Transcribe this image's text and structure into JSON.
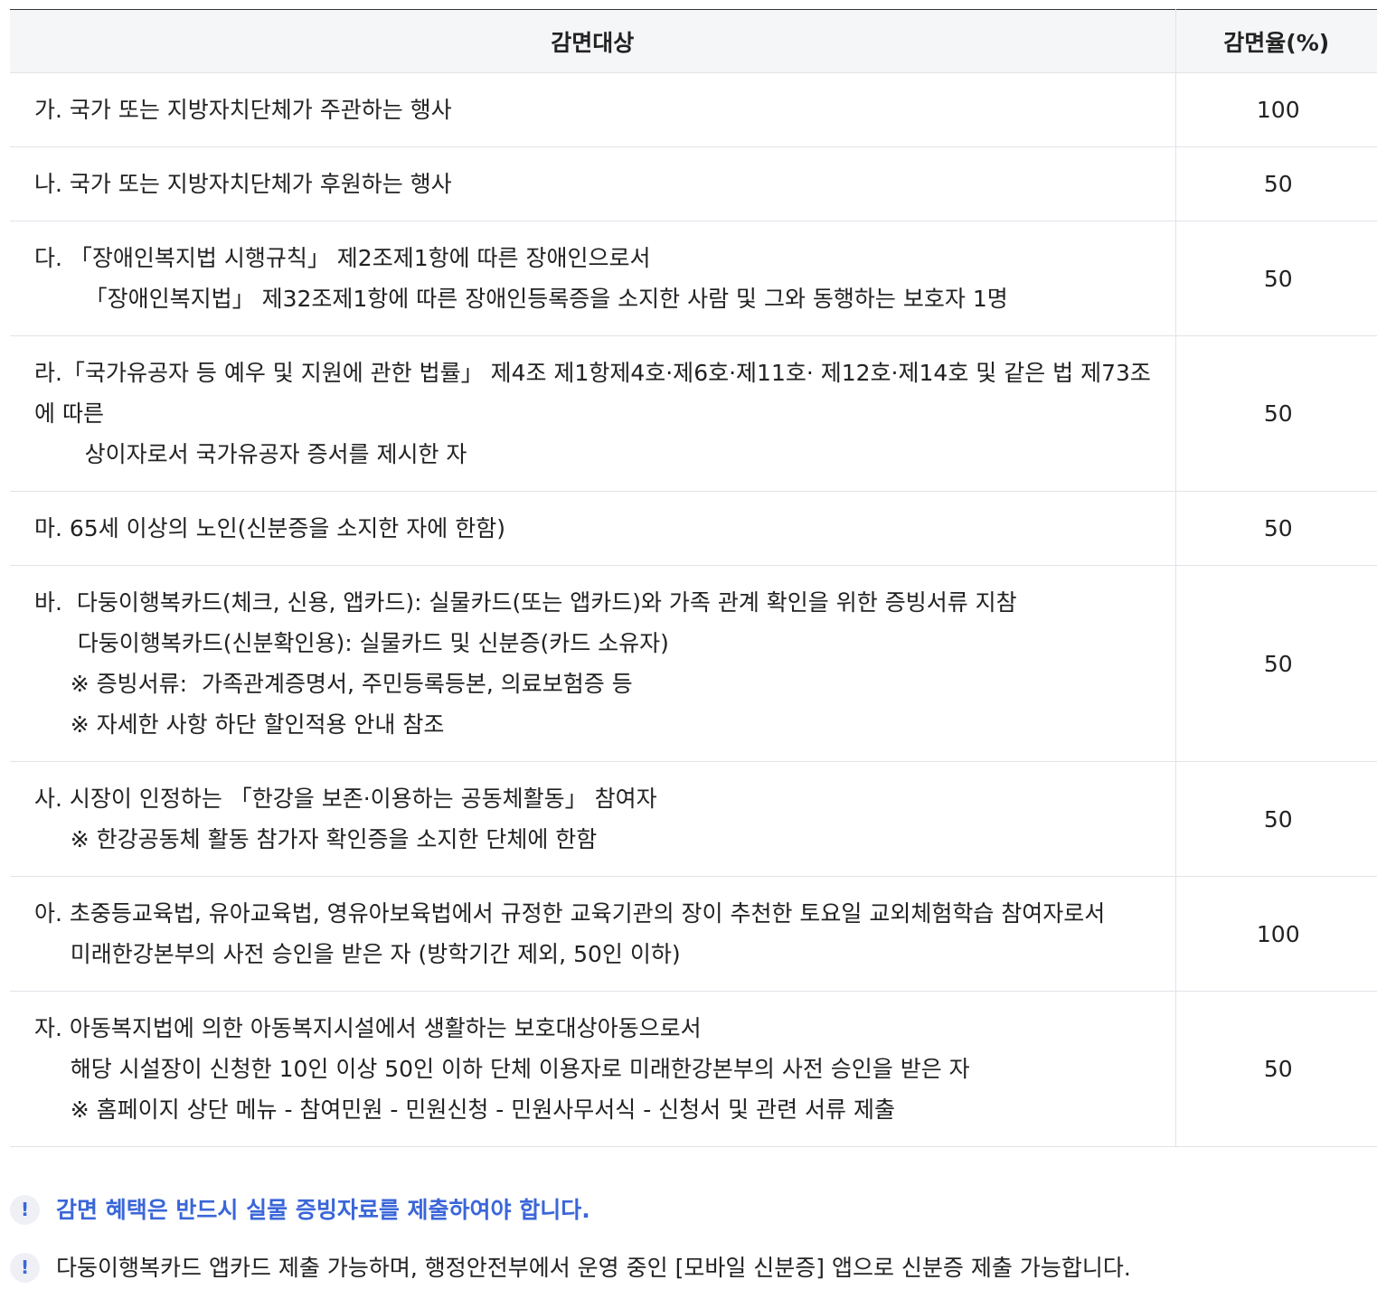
{
  "table": {
    "headers": {
      "target": "감면대상",
      "rate": "감면율(%)"
    },
    "rows": [
      {
        "lines": [
          "가. 국가 또는 지방자치단체가 주관하는 행사"
        ],
        "rate": "100"
      },
      {
        "lines": [
          "나. 국가 또는 지방자치단체가 후원하는 행사"
        ],
        "rate": "50"
      },
      {
        "lines": [
          "다. 「장애인복지법 시행규칙」 제2조제1항에 따른 장애인으로서",
          "       「장애인복지법」 제32조제1항에 따른 장애인등록증을 소지한 사람 및 그와 동행하는 보호자 1명"
        ],
        "rate": "50"
      },
      {
        "lines": [
          "라.「국가유공자 등 예우 및 지원에 관한 법률」 제4조 제1항제4호·제6호·제11호· 제12호·제14호 및 같은 법 제73조에 따른",
          "       상이자로서 국가유공자 증서를 제시한 자"
        ],
        "rate": "50"
      },
      {
        "lines": [
          "마. 65세 이상의 노인(신분증을 소지한 자에 한함)"
        ],
        "rate": "50"
      },
      {
        "lines": [
          "바.  다둥이행복카드(체크, 신용, 앱카드): 실물카드(또는 앱카드)와 가족 관계 확인을 위한 증빙서류 지참",
          "      다둥이행복카드(신분확인용): 실물카드 및 신분증(카드 소유자)",
          "     ※ 증빙서류:  가족관계증명서, 주민등록등본, 의료보험증 등",
          "     ※ 자세한 사항 하단 할인적용 안내 참조"
        ],
        "rate": "50"
      },
      {
        "lines": [
          "사. 시장이 인정하는 「한강을 보존·이용하는 공동체활동」 참여자",
          "     ※ 한강공동체 활동 참가자 확인증을 소지한 단체에 한함"
        ],
        "rate": "50"
      },
      {
        "lines": [
          "아. 초중등교육법, 유아교육법, 영유아보육법에서 규정한 교육기관의 장이 추천한 토요일 교외체험학습 참여자로서",
          "     미래한강본부의 사전 승인을 받은 자 (방학기간 제외, 50인 이하)"
        ],
        "rate": "100"
      },
      {
        "lines": [
          "자. 아동복지법에 의한 아동복지시설에서 생활하는 보호대상아동으로서",
          "     해당 시설장이 신청한 10인 이상 50인 이하 단체 이용자로 미래한강본부의 사전 승인을 받은 자",
          "     ※ 홈페이지 상단 메뉴 - 참여민원 - 민원신청 - 민원사무서식 - 신청서 및 관련 서류 제출"
        ],
        "rate": "50"
      }
    ]
  },
  "notes": [
    {
      "icon": "!",
      "text": "감면 혜택은 반드시 실물 증빙자료를 제출하여야 합니다.",
      "emphasis": true
    },
    {
      "icon": "!",
      "text": "다둥이행복카드 앱카드 제출 가능하며, 행정안전부에서 운영 중인 [모바일 신분증] 앱으로 신분증 제출 가능합니다.",
      "emphasis": false
    }
  ],
  "colors": {
    "accent": "#3a66d8",
    "header_bg": "#f5f6f8",
    "border": "#e1e3e8"
  }
}
